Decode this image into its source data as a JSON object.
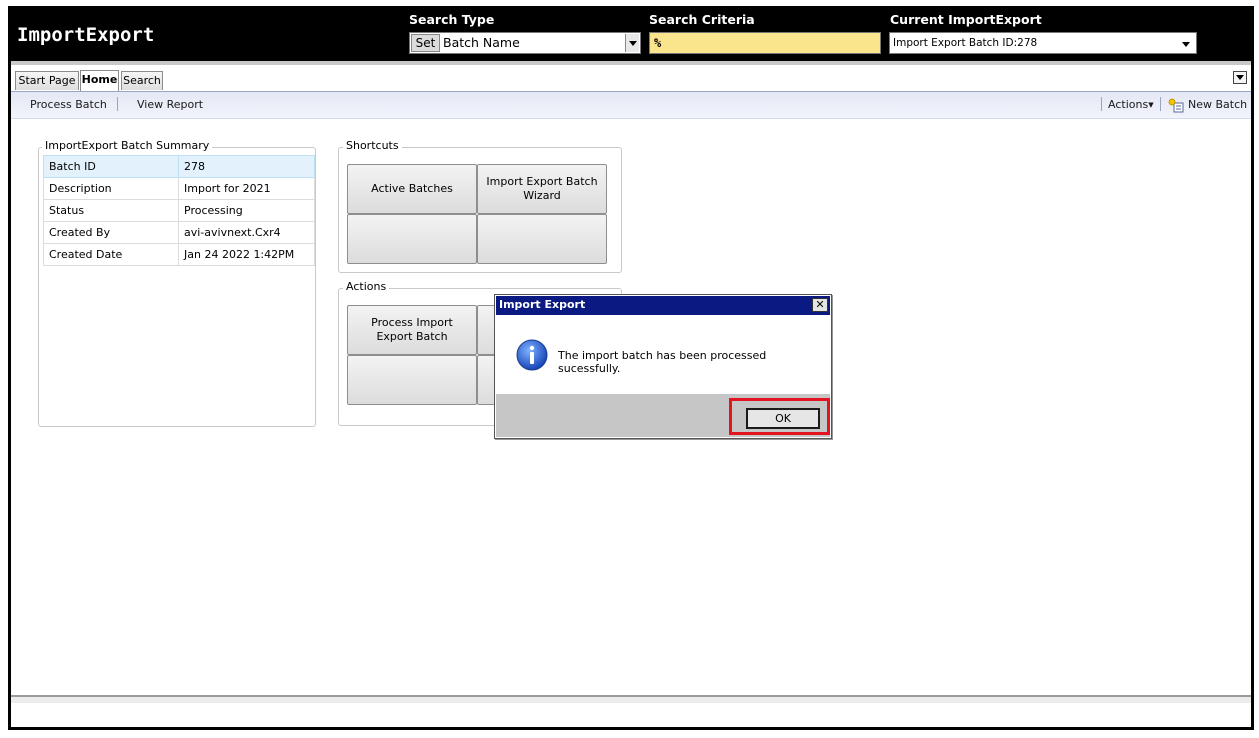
{
  "header": {
    "app_title": "ImportExport",
    "search_type_label": "Search Type",
    "set_button": "Set",
    "search_type_value": "Batch Name",
    "search_criteria_label": "Search Criteria",
    "search_criteria_value": "%",
    "current_label": "Current ImportExport",
    "current_value": "Import Export Batch ID:278"
  },
  "tabs": [
    {
      "label": "Start Page"
    },
    {
      "label": "Home"
    },
    {
      "label": "Search"
    }
  ],
  "toolbar": {
    "process_batch": "Process Batch",
    "view_report": "View Report",
    "actions": "Actions",
    "new_batch": "New Batch"
  },
  "summary": {
    "title": "ImportExport Batch Summary",
    "rows": [
      {
        "label": "Batch ID",
        "value": "278"
      },
      {
        "label": "Description",
        "value": "Import for 2021"
      },
      {
        "label": "Status",
        "value": "Processing"
      },
      {
        "label": "Created By",
        "value": "avi-avivnext.Cxr4"
      },
      {
        "label": "Created Date",
        "value": "Jan 24 2022  1:42PM"
      }
    ]
  },
  "shortcuts": {
    "title": "Shortcuts",
    "buttons": [
      "Active Batches",
      "Import Export Batch Wizard",
      "",
      ""
    ]
  },
  "actions": {
    "title": "Actions",
    "buttons": [
      "Process Import Export Batch",
      "",
      "",
      ""
    ]
  },
  "dialog": {
    "title": "Import Export",
    "close": "✕",
    "message": "The import batch has been processed sucessfully.",
    "ok": "OK"
  },
  "colors": {
    "highlight": "#e3141f",
    "dialog_title_bg": "#0b1a82",
    "criteria_bg": "#fbe58c"
  }
}
